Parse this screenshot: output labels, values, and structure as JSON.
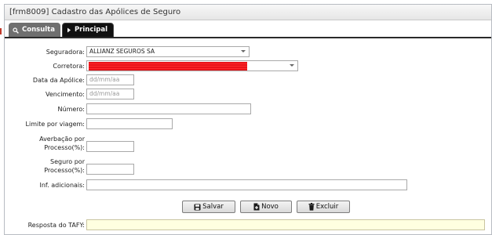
{
  "window": {
    "title": "[frm8009] Cadastro das Apólices de Seguro"
  },
  "tabs": [
    {
      "label": "Consulta",
      "icon": "search-icon"
    },
    {
      "label": "Principal",
      "icon": "caret-right-icon"
    }
  ],
  "form": {
    "seguradora": {
      "label": "Seguradora:",
      "value": "ALLIANZ SEGUROS SA"
    },
    "corretora": {
      "label": "Corretora:",
      "value": ""
    },
    "data_apolice": {
      "label": "Data da Apólice:",
      "placeholder": "dd/mm/aa"
    },
    "vencimento": {
      "label": "Vencimento:",
      "placeholder": "dd/mm/aa"
    },
    "numero": {
      "label": "Número:",
      "value": ""
    },
    "limite_viagem": {
      "label": "Limite por viagem:",
      "value": ""
    },
    "averbacao": {
      "label_line1": "Averbação por",
      "label_line2": "Processo(%):",
      "value": ""
    },
    "seguro": {
      "label_line1": "Seguro por",
      "label_line2": "Processo(%):",
      "value": ""
    },
    "inf_adicionais": {
      "label": "Inf. adicionais:",
      "value": ""
    },
    "resposta_tafy": {
      "label": "Resposta do TAFY:",
      "value": ""
    }
  },
  "buttons": {
    "salvar": "Salvar",
    "novo": "Novo",
    "excluir": "Excluir"
  }
}
